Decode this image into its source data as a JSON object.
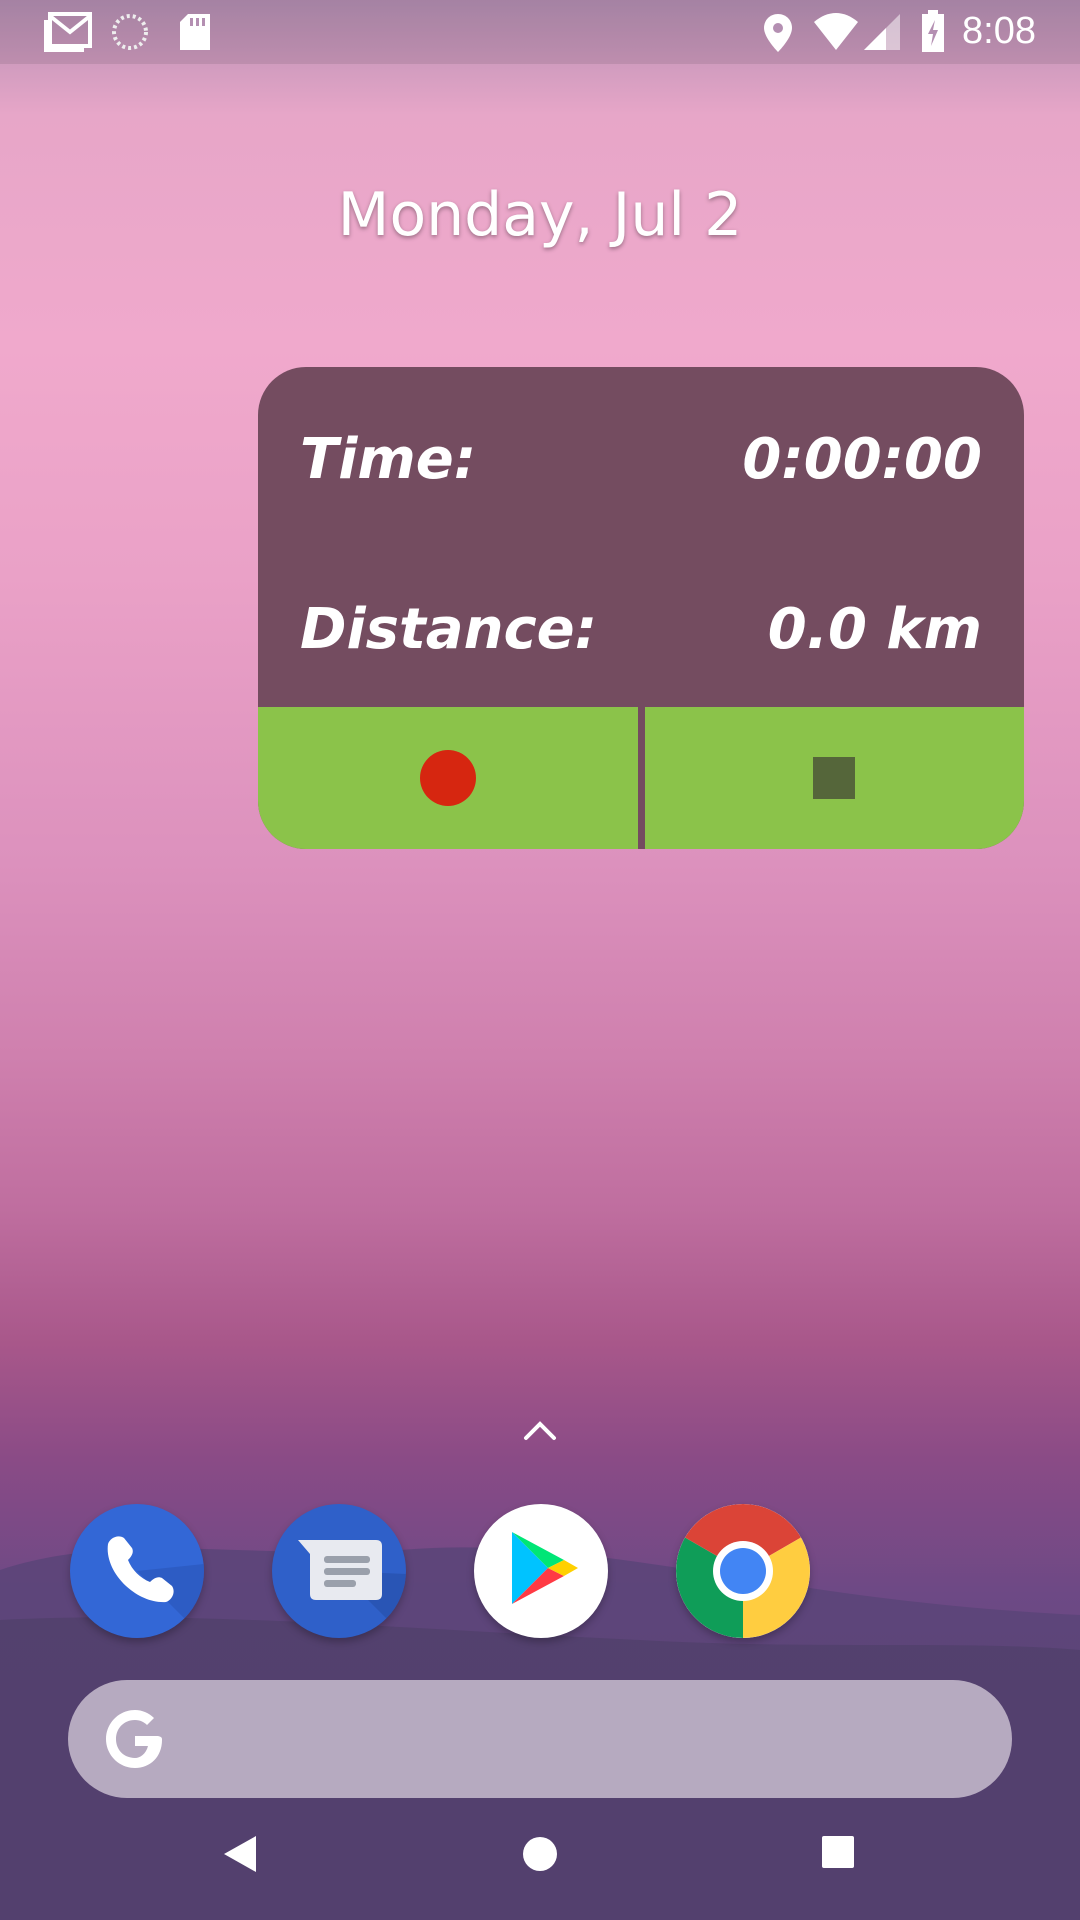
{
  "status_bar": {
    "time": "8:08",
    "left_icons": [
      "gmail-icon",
      "sync-icon",
      "sd-card-icon"
    ],
    "right_icons": [
      "location-icon",
      "wifi-icon",
      "signal-icon",
      "battery-charging-icon"
    ]
  },
  "home": {
    "date": "Monday, Jul 2"
  },
  "widget": {
    "time_label": "Time:",
    "time_value": "0:00:00",
    "distance_label": "Distance:",
    "distance_value": "0.0 km",
    "colors": {
      "panel": "#744c60",
      "buttons": "#8bc34a",
      "record": "#d62610",
      "stop": "#55663a"
    },
    "buttons": [
      "record-icon",
      "stop-icon"
    ]
  },
  "dock": {
    "apps": [
      "phone-icon",
      "messages-icon",
      "play-store-icon",
      "chrome-icon"
    ]
  },
  "search_bar": {
    "icon": "google-g-icon"
  },
  "nav_bar": {
    "items": [
      "back-icon",
      "home-icon",
      "recents-icon"
    ]
  }
}
